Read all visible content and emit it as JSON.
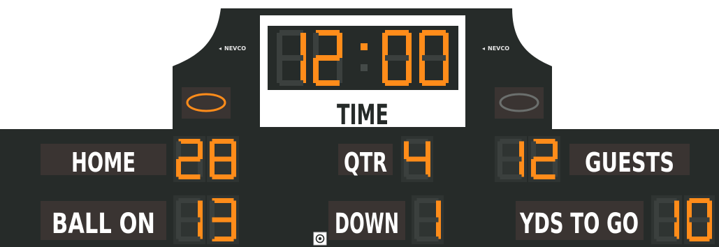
{
  "brand": {
    "left_logo": "NEVCO",
    "right_logo": "NEVCO"
  },
  "clock": {
    "value": "12:00",
    "minutes": "12",
    "seconds": "00",
    "label": "TIME"
  },
  "possession": {
    "home_active": true,
    "guests_active": false,
    "icon": "football-possession-icon"
  },
  "home": {
    "label": "HOME",
    "score": "28"
  },
  "guests": {
    "label": "GUESTS",
    "score": "12"
  },
  "quarter": {
    "label": "QTR",
    "value": "4"
  },
  "ball_on": {
    "label": "BALL ON",
    "value": "13"
  },
  "down": {
    "label": "DOWN",
    "value": "1"
  },
  "yards_to_go": {
    "label": "YDS TO GO",
    "value": "10"
  },
  "colors": {
    "board": "#262b29",
    "digit_on": "#ff8c1a",
    "digit_off": "#3b403e",
    "label_bg": "#3a3432",
    "time_panel": "#ffffff",
    "label_text": "#ffffff"
  },
  "icons": [
    "football-possession-icon",
    "camera-icon",
    "nevco-logo-icon"
  ]
}
